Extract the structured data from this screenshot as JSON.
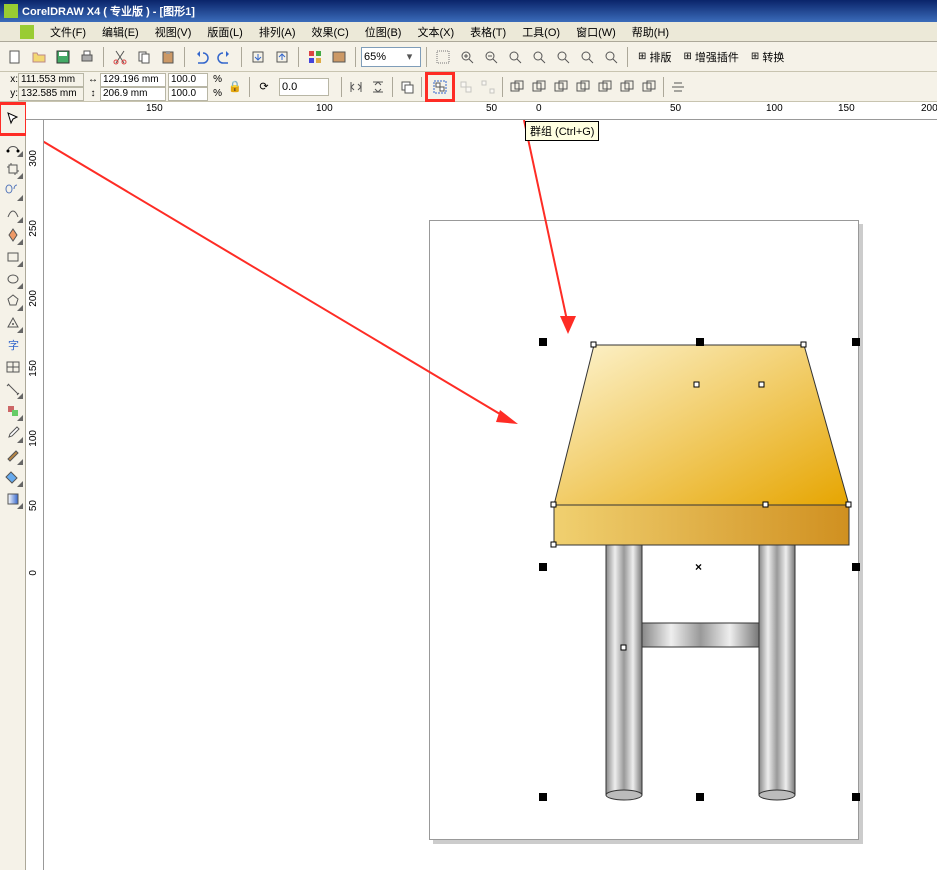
{
  "title": "CorelDRAW X4 ( 专业版 ) - [图形1]",
  "menus": [
    "文件(F)",
    "编辑(E)",
    "视图(V)",
    "版面(L)",
    "排列(A)",
    "效果(C)",
    "位图(B)",
    "文本(X)",
    "表格(T)",
    "工具(O)",
    "窗口(W)",
    "帮助(H)"
  ],
  "zoom": "65%",
  "coords": {
    "x": "111.553 mm",
    "y": "132.585 mm",
    "w": "129.196 mm",
    "h": "206.9 mm",
    "sx": "100.0",
    "sy": "100.0"
  },
  "rotation": "0.0",
  "tooltip": "群组 (Ctrl+G)",
  "ruler_h": [
    {
      "pos": 120,
      "val": "150"
    },
    {
      "pos": 290,
      "val": "100"
    },
    {
      "pos": 460,
      "val": "50"
    },
    {
      "pos": 510,
      "val": "0"
    },
    {
      "pos": 644,
      "val": "50"
    },
    {
      "pos": 740,
      "val": "100"
    },
    {
      "pos": 812,
      "val": "150"
    },
    {
      "pos": 895,
      "val": "200"
    }
  ],
  "ruler_v": [
    {
      "pos": 30,
      "val": "300"
    },
    {
      "pos": 100,
      "val": "250"
    },
    {
      "pos": 170,
      "val": "200"
    },
    {
      "pos": 240,
      "val": "150"
    },
    {
      "pos": 310,
      "val": "100"
    },
    {
      "pos": 380,
      "val": "50"
    },
    {
      "pos": 450,
      "val": "0"
    }
  ],
  "toolbar1_right": [
    "排版",
    "增强插件",
    "转换"
  ],
  "pct": "%",
  "lock_icon": "🔒",
  "o_icon": "⟳"
}
